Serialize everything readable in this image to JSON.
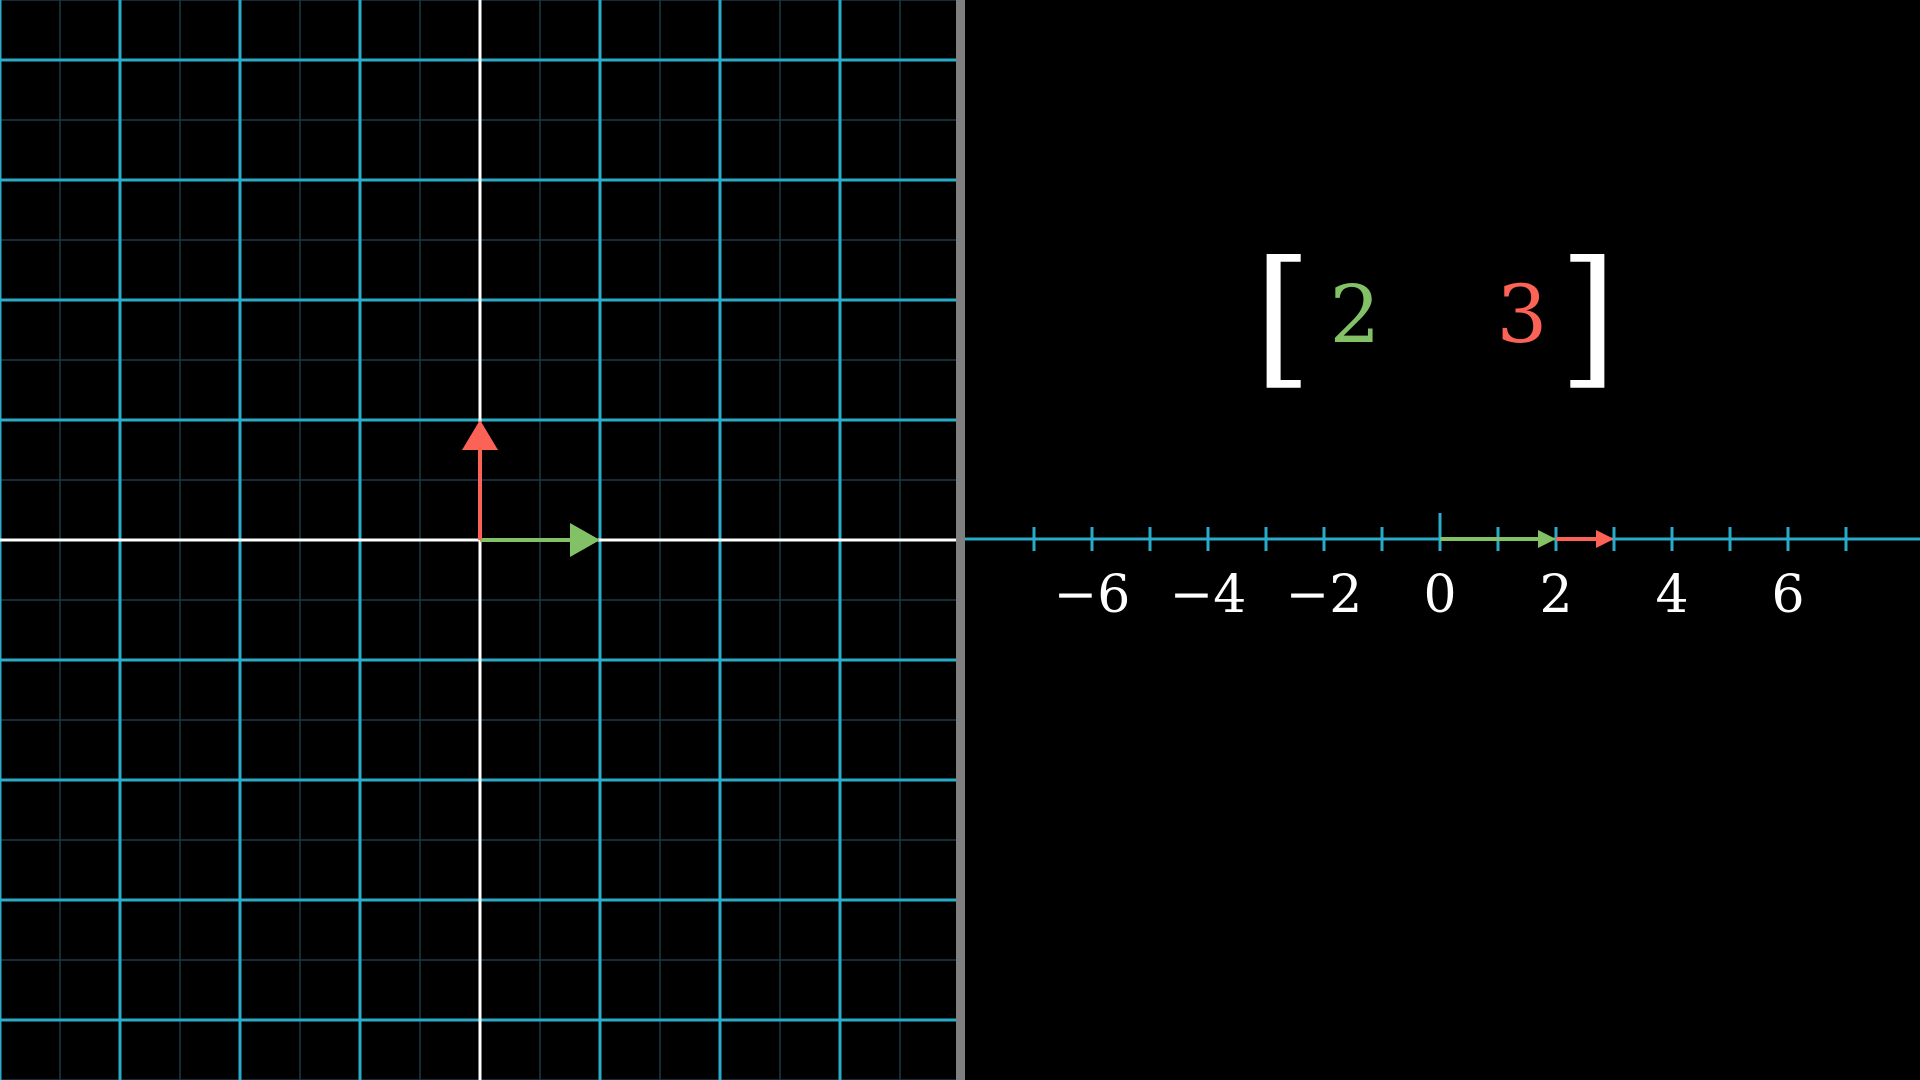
{
  "scene": {
    "colors": {
      "background": "#000000",
      "grid_major": "#29abca",
      "grid_minor": "#1b3a4a",
      "axis": "#ffffff",
      "divider": "#7f7f7f",
      "i_hat": "#83c167",
      "j_hat": "#fc6255",
      "text": "#ffffff"
    }
  },
  "plane": {
    "x_range": [
      -4,
      4
    ],
    "y_range": [
      -4.5,
      4.5
    ],
    "i_hat": [
      1,
      0
    ],
    "j_hat": [
      0,
      1
    ]
  },
  "matrix": {
    "left_bracket": "[",
    "right_bracket": "]",
    "entries": [
      "2",
      "3"
    ],
    "entry_colors": [
      "#83c167",
      "#fc6255"
    ]
  },
  "number_line": {
    "range": [
      -7,
      8
    ],
    "ticks": [
      -7,
      -6,
      -5,
      -4,
      -3,
      -2,
      -1,
      0,
      1,
      2,
      3,
      4,
      5,
      6,
      7
    ],
    "labels": [
      "−6",
      "−4",
      "−2",
      "0",
      "2",
      "4",
      "6"
    ],
    "label_values": [
      -6,
      -4,
      -2,
      0,
      2,
      4,
      6
    ],
    "i_hat_image": 2,
    "j_hat_image": 3
  }
}
